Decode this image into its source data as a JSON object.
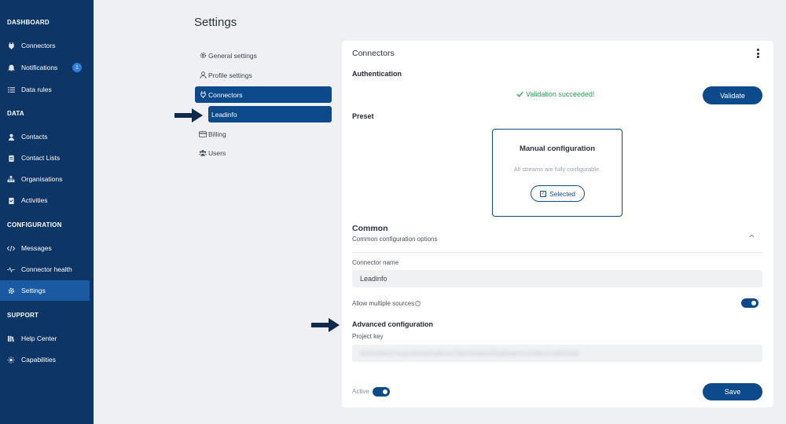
{
  "sidebar": {
    "sections": [
      "DASHBOARD",
      "DATA",
      "CONFIGURATION",
      "SUPPORT"
    ],
    "items": [
      {
        "label": "Connectors",
        "icon": "plug-icon"
      },
      {
        "label": "Notifications",
        "icon": "bell-icon",
        "badge": "1"
      },
      {
        "label": "Data rules",
        "icon": "list-icon"
      },
      {
        "label": "Contacts",
        "icon": "person-icon"
      },
      {
        "label": "Contact Lists",
        "icon": "clipboard-icon"
      },
      {
        "label": "Organisations",
        "icon": "org-icon"
      },
      {
        "label": "Activities",
        "icon": "activity-icon"
      },
      {
        "label": "Messages",
        "icon": "code-icon"
      },
      {
        "label": "Connector health",
        "icon": "pulse-icon"
      },
      {
        "label": "Settings",
        "icon": "gear-icon",
        "active": true
      },
      {
        "label": "Help Center",
        "icon": "book-icon"
      },
      {
        "label": "Capabilities",
        "icon": "capabilities-icon"
      }
    ]
  },
  "page": {
    "title": "Settings"
  },
  "settings_nav": [
    {
      "label": "General settings",
      "icon": "gear-icon"
    },
    {
      "label": "Profile settings",
      "icon": "person-icon"
    },
    {
      "label": "Connectors",
      "icon": "plug-icon",
      "active": true
    },
    {
      "label": "Leadinfo",
      "sub": true
    },
    {
      "label": "Billing",
      "icon": "card-icon"
    },
    {
      "label": "Users",
      "icon": "users-icon"
    }
  ],
  "card": {
    "title": "Connectors",
    "authentication": {
      "heading": "Authentication",
      "status": "Validation succeeded!",
      "validate_label": "Validate"
    },
    "preset": {
      "heading": "Preset",
      "title": "Manual configuration",
      "description": "All streams are fully configurable.",
      "selected_label": "Selected"
    },
    "common": {
      "heading": "Common",
      "subtitle": "Common configuration options",
      "connector_name_label": "Connector name",
      "connector_name_value": "Leadinfo",
      "allow_multiple_label": "Allow multiple sources",
      "allow_multiple": true
    },
    "advanced": {
      "heading": "Advanced configuration",
      "project_key_label": "Project key",
      "project_key_value": "Wd2nRMo2lYqrpy2kHJdSndR2mTRpHSAwtw3N2gRbaHVm5nWeJ2vMiXSdt3"
    },
    "footer": {
      "active_label": "Active",
      "active": true,
      "save_label": "Save"
    }
  },
  "colors": {
    "sidebar": "#0d3566",
    "accent": "#0d4a8c",
    "success": "#27a050"
  }
}
